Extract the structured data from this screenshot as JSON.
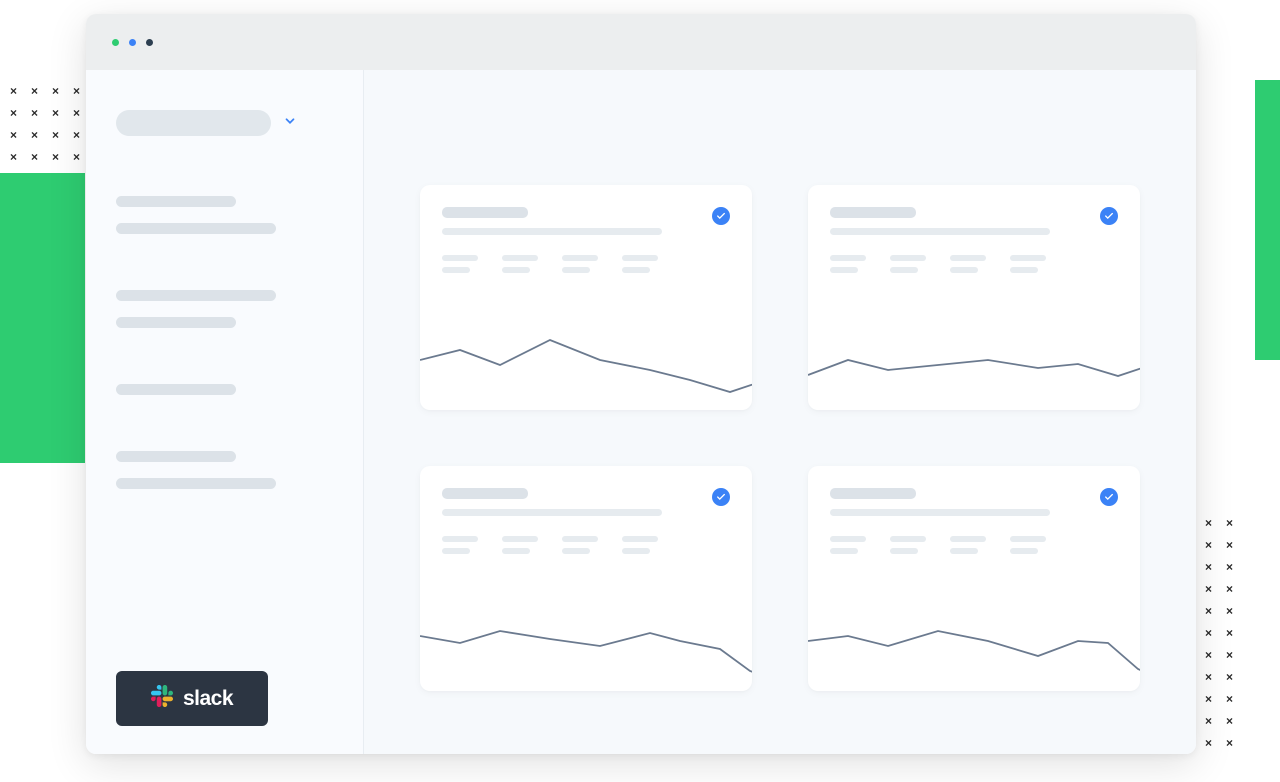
{
  "sidebar": {
    "footer_button_label": "slack"
  },
  "cards": [
    {
      "sparkline_points": [
        0,
        50,
        40,
        60,
        80,
        45,
        130,
        70,
        180,
        50,
        230,
        40,
        270,
        30,
        310,
        18,
        340,
        28,
        360,
        10
      ]
    },
    {
      "sparkline_points": [
        0,
        35,
        40,
        50,
        80,
        40,
        130,
        45,
        180,
        50,
        230,
        42,
        270,
        46,
        310,
        34,
        340,
        44,
        360,
        30
      ]
    },
    {
      "sparkline_points": [
        0,
        55,
        40,
        48,
        80,
        60,
        130,
        52,
        180,
        45,
        230,
        58,
        260,
        50,
        300,
        42,
        330,
        20,
        360,
        10
      ]
    },
    {
      "sparkline_points": [
        0,
        50,
        40,
        55,
        80,
        45,
        130,
        60,
        180,
        50,
        230,
        35,
        270,
        50,
        300,
        48,
        330,
        22,
        360,
        8
      ]
    }
  ],
  "colors": {
    "sparkline_stroke": "#6b7a8f"
  }
}
